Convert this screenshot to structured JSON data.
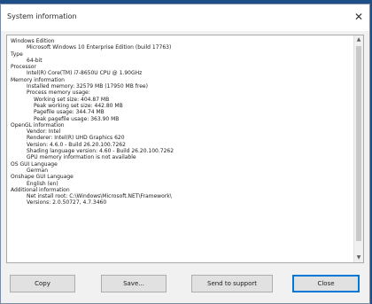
{
  "window": {
    "title": "System information",
    "close_glyph": "✕"
  },
  "info_lines": [
    "Windows Edition",
    "Microsoft Windows 10 Enterprise Edition (build 17763)",
    "Type",
    "64-bit",
    "Processor",
    "Intel(R) Core(TM) i7-8650U CPU @ 1.90GHz",
    "Memory information",
    "Installed memory: 32579 MB (17950 MB free)",
    "Process memory usage:",
    "Working set size: 404.87 MB",
    "Peak working set size: 442.80 MB",
    "Pagefile usage: 344.74 MB",
    "Peak pagefile usage: 363.90 MB",
    "OpenGL information",
    "Vendor: Intel",
    "Renderer: Intel(R) UHD Graphics 620",
    "Version: 4.6.0 - Build 26.20.100.7262",
    "Shading language version: 4.60 - Build 26.20.100.7262",
    "GPU memory information is not available",
    "OS GUI Language",
    "German",
    "Onshape GUI Language",
    "English (en)",
    "Additional information",
    "Net install root: C:\\Windows\\Microsoft.NET\\Framework\\",
    "Versions: 2.0.50727, 4.7.3460"
  ],
  "buttons": {
    "copy": "Copy",
    "save": "Save...",
    "send": "Send to support",
    "close": "Close"
  },
  "scrollbar": {
    "up_glyph": "▲",
    "down_glyph": "▼"
  }
}
